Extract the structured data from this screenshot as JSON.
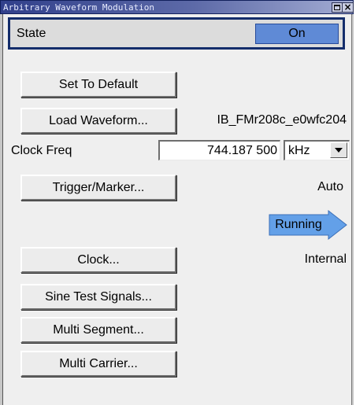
{
  "window": {
    "title": "Arbitrary Waveform Modulation"
  },
  "state": {
    "label": "State",
    "value": "On"
  },
  "buttons": {
    "set_default": "Set To Default",
    "load_waveform": "Load Waveform...",
    "trigger_marker": "Trigger/Marker...",
    "clock": "Clock...",
    "sine_test": "Sine Test Signals...",
    "multi_segment": "Multi Segment...",
    "multi_carrier": "Multi Carrier..."
  },
  "waveform": {
    "filename": "IB_FMr208c_e0wfc204"
  },
  "clock_freq": {
    "label": "Clock Freq",
    "value": "744.187 500",
    "unit": "kHz"
  },
  "trigger": {
    "mode": "Auto",
    "status": "Running"
  },
  "clock": {
    "source": "Internal"
  },
  "colors": {
    "state_value_bg": "#5f8ad6",
    "running_arrow": "#63a0e8",
    "title_bar": "#31408b"
  }
}
